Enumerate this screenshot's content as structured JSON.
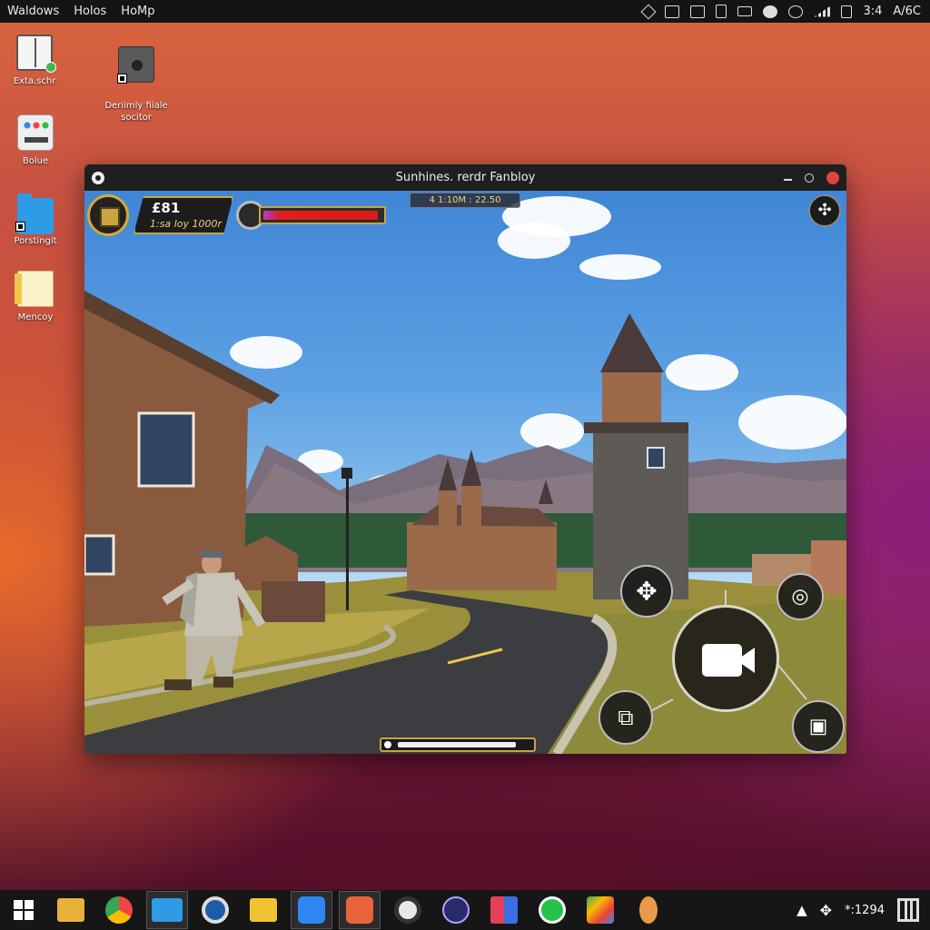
{
  "topbar": {
    "menus": [
      "Waldows",
      "Holos",
      "HoMp"
    ],
    "tray_time": "3:4",
    "tray_lang": "A/6C",
    "tray_icons": [
      "network-icon",
      "monitor-icon",
      "display-icon",
      "clipboard-icon",
      "camera-icon",
      "app-icon",
      "record-icon",
      "signal-bars-icon",
      "battery-icon"
    ]
  },
  "desktop": {
    "icons": [
      {
        "label": "Exta.schr",
        "icon": "book-icon"
      },
      {
        "label": "Deriimly fiiale\nsocitor",
        "icon": "disk-icon"
      },
      {
        "label": "Bolue",
        "icon": "apps-icon"
      },
      {
        "label": "Porstingit",
        "icon": "folder-icon"
      },
      {
        "label": "Mencoy",
        "icon": "memo-icon"
      }
    ]
  },
  "window": {
    "title": "Sunhines. rerdr Fanbloy"
  },
  "game": {
    "score_main": "£81",
    "score_sub": "1:sa loy 1000r",
    "health_fraction": 0.97,
    "top_info": "4 1:10M : 22.50",
    "controls": [
      {
        "name": "move-button",
        "glyph": "✥"
      },
      {
        "name": "snapshot-button",
        "glyph": "◎"
      },
      {
        "name": "record-button",
        "glyph": "▮"
      },
      {
        "name": "screenshot-button",
        "glyph": "⧉"
      },
      {
        "name": "video-button",
        "glyph": "▣"
      }
    ]
  },
  "taskbar": {
    "apps": [
      "start-icon",
      "file-explorer-icon",
      "browser-icon",
      "files-icon",
      "camera-app-icon",
      "notes-icon",
      "app-store-icon",
      "game-app-icon",
      "steam-icon",
      "globe-icon",
      "windows-app-icon",
      "whatsapp-icon",
      "play-store-icon",
      "character-app-icon"
    ],
    "tray_clock": "*:1294"
  }
}
